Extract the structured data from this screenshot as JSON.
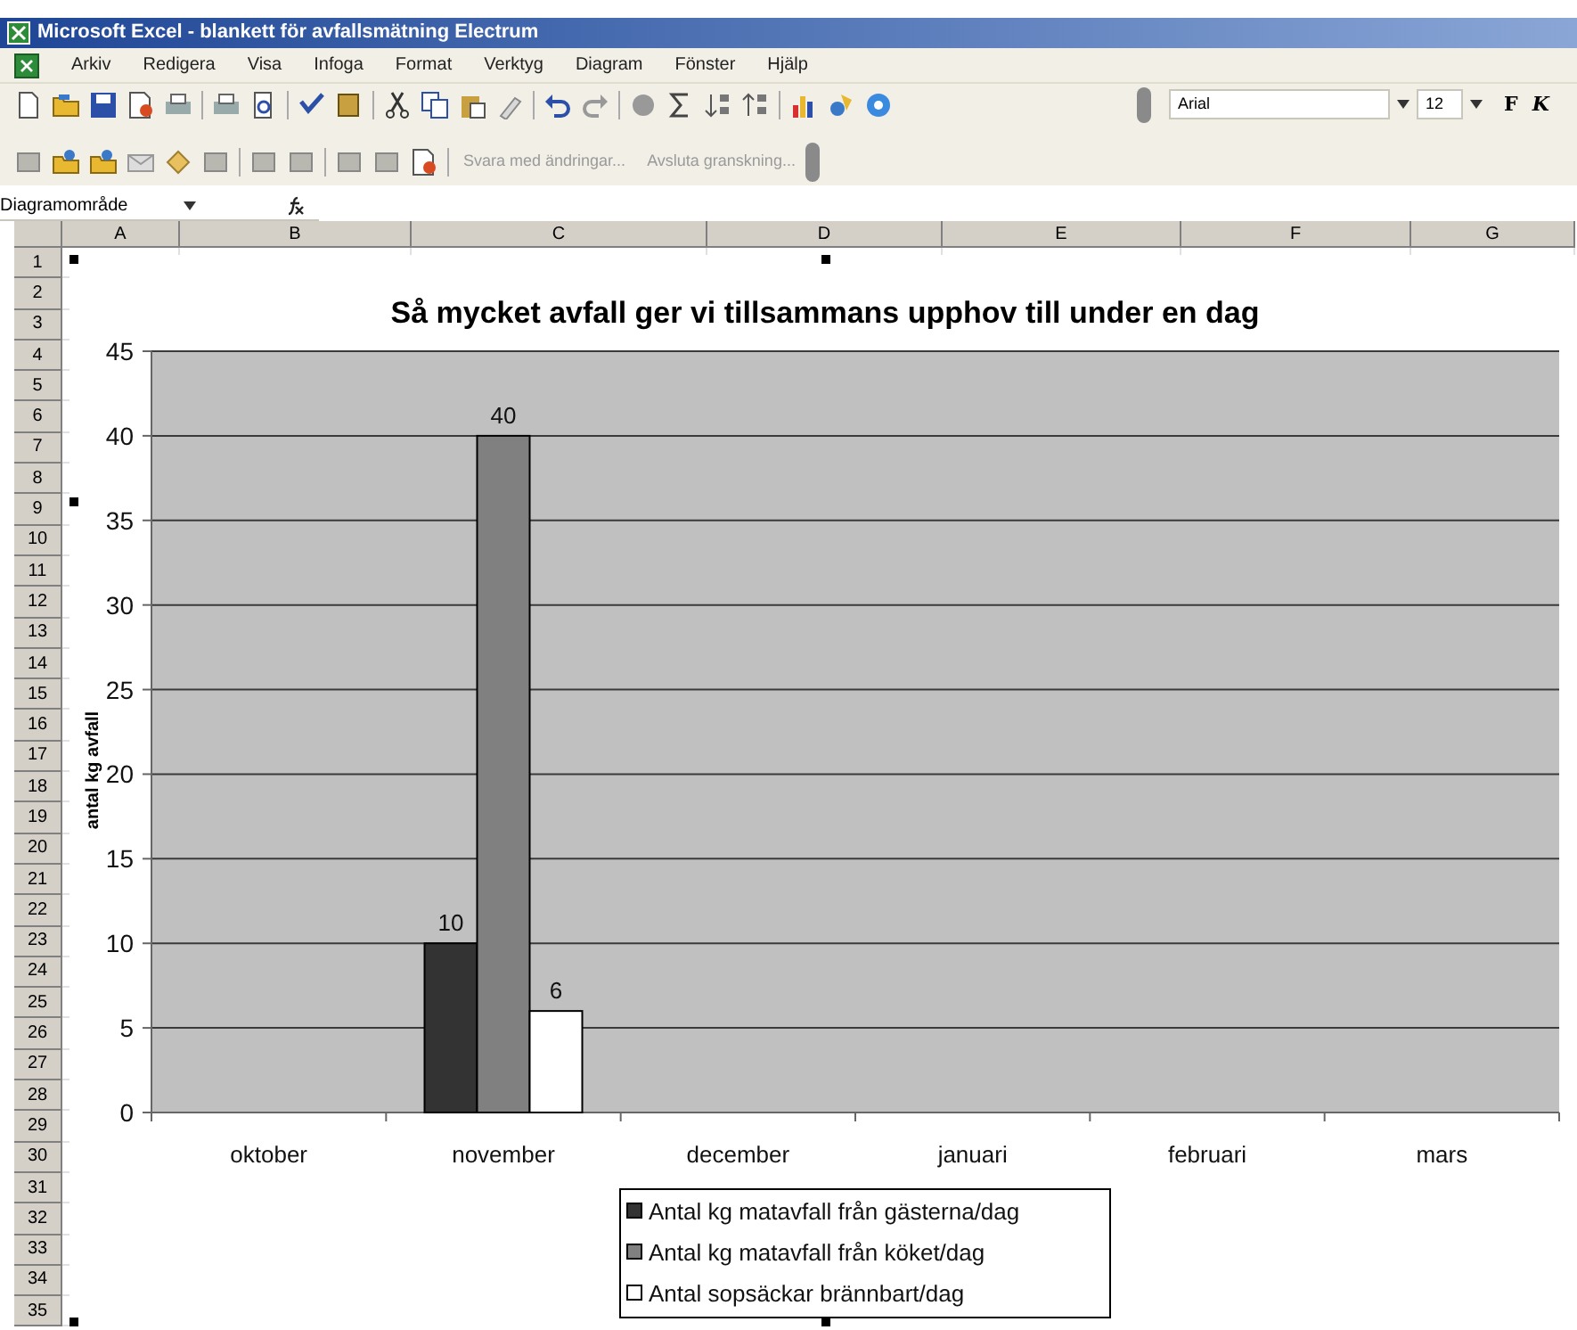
{
  "window": {
    "title": "Microsoft Excel - blankett för avfallsmätning Electrum"
  },
  "menu": [
    "Arkiv",
    "Redigera",
    "Visa",
    "Infoga",
    "Format",
    "Verktyg",
    "Diagram",
    "Fönster",
    "Hjälp"
  ],
  "formatting": {
    "font": "Arial",
    "size": "12",
    "bold_label": "F",
    "italic_label": "K"
  },
  "review_toolbar": [
    {
      "label": "Svara med ändringar...",
      "disabled": true
    },
    {
      "label": "Avsluta granskning...",
      "disabled": true
    }
  ],
  "formula_bar": {
    "name_box": "Diagramområde"
  },
  "columns": [
    "A",
    "B",
    "C",
    "D",
    "E",
    "F",
    "G"
  ],
  "rows": [
    "1",
    "2",
    "3",
    "4",
    "5",
    "6",
    "7",
    "8",
    "9",
    "10",
    "11",
    "12",
    "13",
    "14",
    "15",
    "16",
    "17",
    "18",
    "19",
    "20",
    "21",
    "22",
    "23",
    "24",
    "25",
    "26",
    "27",
    "28",
    "29",
    "30",
    "31",
    "32",
    "33",
    "34",
    "35"
  ],
  "chart": {
    "selected": true,
    "chart_data": {
      "type": "bar",
      "title": "Så mycket avfall ger vi tillsammans upphov till under en dag",
      "ylabel": "antal kg avfall",
      "categories": [
        "oktober",
        "november",
        "december",
        "januari",
        "februari",
        "mars"
      ],
      "series": [
        {
          "name": "Antal kg matavfall från gästerna/dag",
          "color": "#333333",
          "values": [
            null,
            10,
            null,
            null,
            null,
            null
          ]
        },
        {
          "name": "Antal kg matavfall från köket/dag",
          "color": "#808080",
          "values": [
            null,
            40,
            null,
            null,
            null,
            null
          ]
        },
        {
          "name": "Antal sopsäckar brännbart/dag",
          "color": "#ffffff",
          "values": [
            null,
            6,
            null,
            null,
            null,
            null
          ]
        }
      ],
      "grid": true,
      "legend": true,
      "ylim": [
        0,
        45
      ],
      "yticks": [
        0,
        5,
        10,
        15,
        20,
        25,
        30,
        35,
        40,
        45
      ],
      "data_labels": true
    }
  }
}
